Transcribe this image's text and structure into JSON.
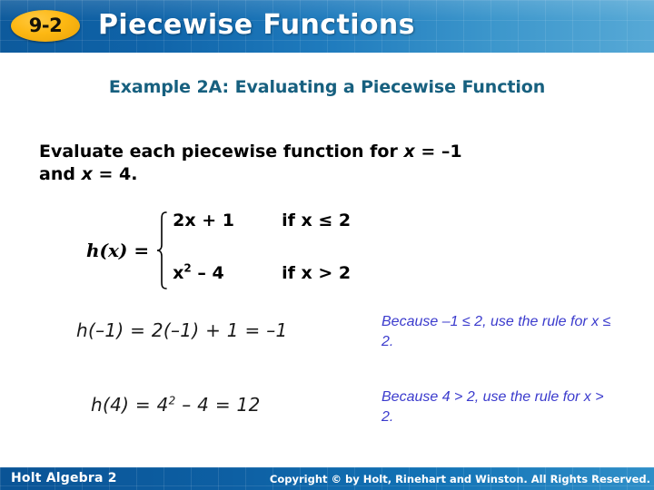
{
  "header": {
    "badge_label": "9-2",
    "title": "Piecewise Functions",
    "band_color_left": "#0d5a9c",
    "band_color_right": "#57a9d6",
    "badge_color": "#fdb813"
  },
  "subtitle": {
    "text": "Example 2A: Evaluating a Piecewise Function",
    "color": "#17607f"
  },
  "prompt": {
    "line1_a": "Evaluate each piecewise function for ",
    "line1_var": "x",
    "line1_b": " = –1",
    "line2_a": "and ",
    "line2_var": "x",
    "line2_b": " = 4."
  },
  "piecewise": {
    "function_name": "h(x) =",
    "rows": [
      {
        "expression": "2x + 1",
        "expr_base": "2x + 1",
        "exponent": "",
        "condition": "if x ≤ 2"
      },
      {
        "expression": "x² – 4",
        "expr_base": "x",
        "exponent": "2",
        "expr_tail": " – 4",
        "condition": "if x > 2"
      }
    ]
  },
  "solutions": [
    {
      "work": "h(–1) = 2(–1) + 1 = –1",
      "reason": "Because –1 ≤ 2, use the rule for x ≤ 2.",
      "reason_color": "#3b3bcd"
    },
    {
      "work_base": "h(4) = 4",
      "work_exponent": "2",
      "work_tail": " – 4 = 12",
      "work": "h(4) = 4² – 4 = 12",
      "reason": "Because 4 > 2, use the rule for x > 2.",
      "reason_color": "#3b3bcd"
    }
  ],
  "footer": {
    "left_text": "Holt Algebra 2",
    "copyright": "Copyright © by Holt, Rinehart and Winston. All Rights Reserved."
  }
}
